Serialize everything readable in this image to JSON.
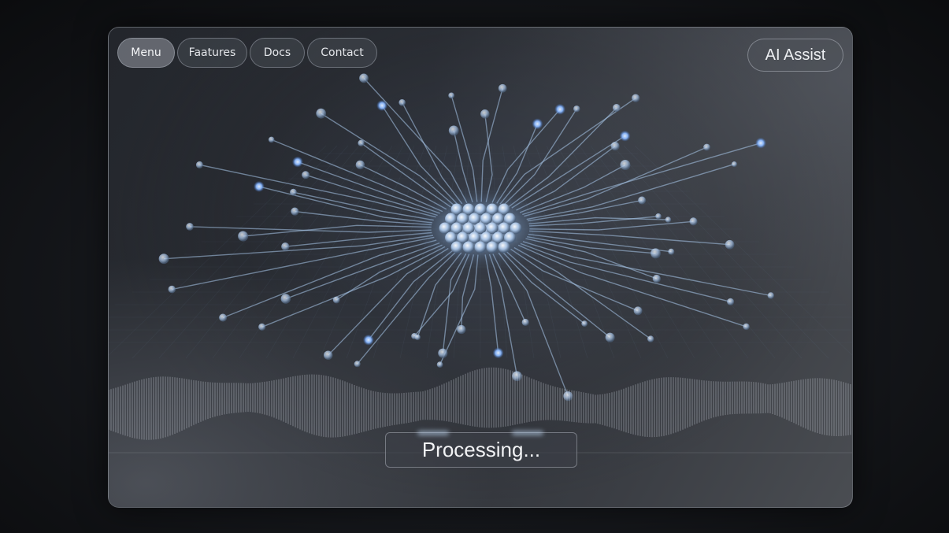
{
  "nav": {
    "items": [
      {
        "label": "Menu",
        "active": true
      },
      {
        "label": "Faatures",
        "active": false
      },
      {
        "label": "Docs",
        "active": false
      },
      {
        "label": "Contact",
        "active": false
      }
    ]
  },
  "assist_label": "AI Assist",
  "status_label": "Processing...",
  "colors": {
    "accent_glow": "#9fc6ff",
    "panel_border": "#c8cdd7",
    "text": "#eceef1"
  },
  "icons": [
    "neural-circuit-graphic",
    "audio-waveform"
  ]
}
